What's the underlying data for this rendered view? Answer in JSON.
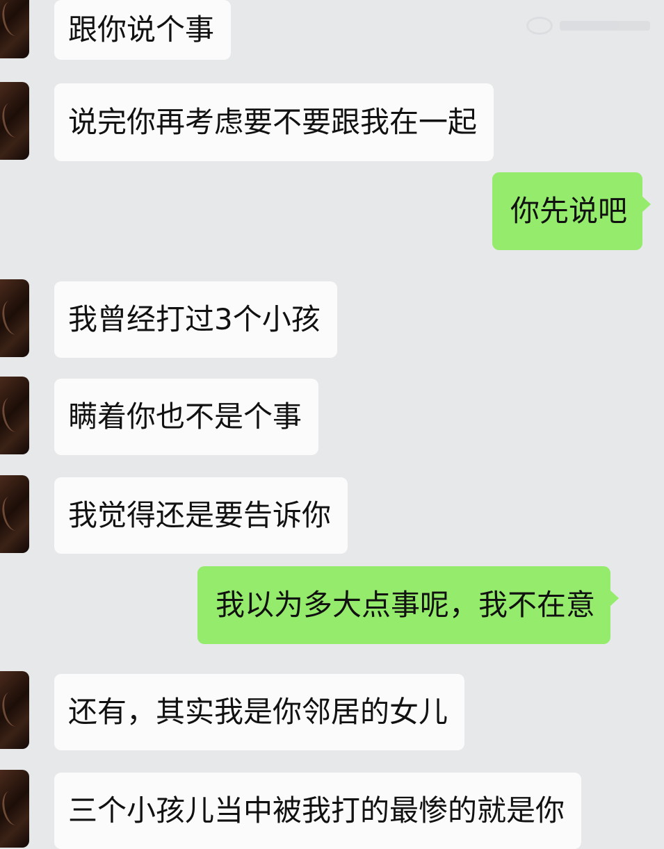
{
  "conversation": {
    "messages": [
      {
        "side": "left",
        "text": "跟你说个事"
      },
      {
        "side": "left",
        "text": "说完你再考虑要不要跟我在一起"
      },
      {
        "side": "right",
        "text": "你先说吧"
      },
      {
        "side": "left",
        "text": "我曾经打过3个小孩"
      },
      {
        "side": "left",
        "text": "瞒着你也不是个事"
      },
      {
        "side": "left",
        "text": "我觉得还是要告诉你"
      },
      {
        "side": "right",
        "text": "我以为多大点事呢，我不在意"
      },
      {
        "side": "left",
        "text": "还有，其实我是你邻居的女儿"
      },
      {
        "side": "left",
        "text": "三个小孩儿当中被我打的最惨的就是你"
      }
    ]
  },
  "colors": {
    "background": "#e7e8ea",
    "incoming_bubble": "#fbfbfb",
    "outgoing_bubble": "#95eb6b",
    "text": "#111111"
  },
  "icons": {
    "avatar": "contact-avatar-photo",
    "watermark": "video-platform-watermark"
  }
}
